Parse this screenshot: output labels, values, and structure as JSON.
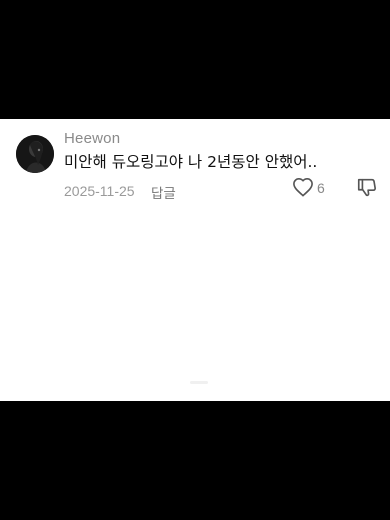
{
  "comment": {
    "username": "Heewon",
    "text": "미안해 듀오링고야 나 2년동안 안했어..",
    "date": "2025-11-25",
    "reply_label": "답글",
    "like_count": "6",
    "icons": {
      "like": "heart-outline-icon",
      "dislike": "thumbs-down-icon"
    }
  },
  "colors": {
    "background_outer": "#000000",
    "panel": "#ffffff",
    "username": "#8a8a8a",
    "text": "#111111",
    "meta": "#9a9a9a"
  }
}
